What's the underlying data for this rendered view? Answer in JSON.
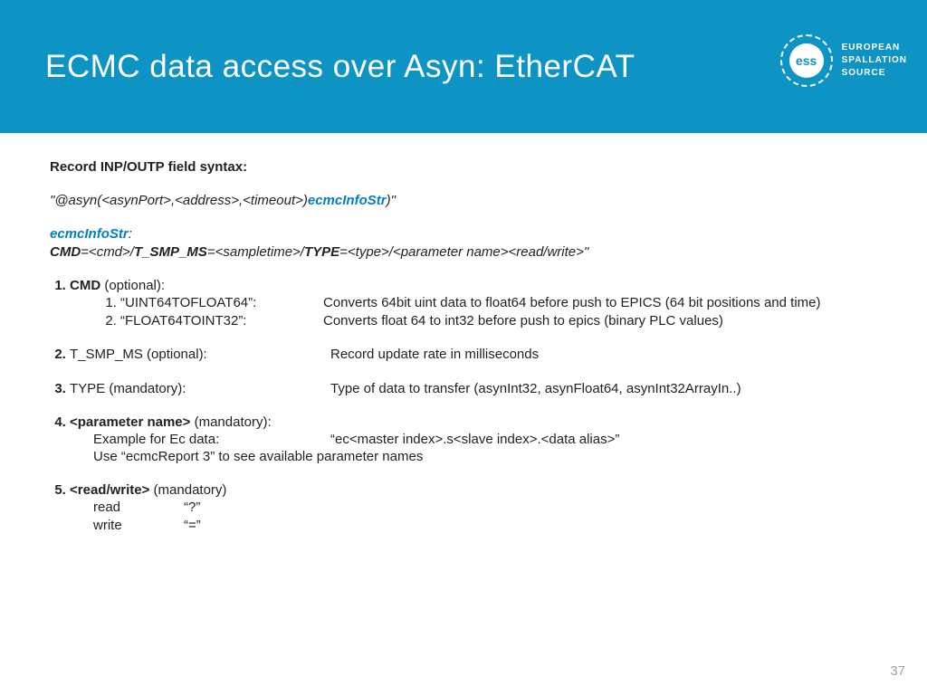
{
  "header": {
    "title": "ECMC data access over Asyn: EtherCAT",
    "org_line1": "EUROPEAN",
    "org_line2": "SPALLATION",
    "org_line3": "SOURCE",
    "logo_text": "ess"
  },
  "section_heading": "Record INP/OUTP field syntax:",
  "syntax": {
    "prefix": "\"@asyn(<asynPort>,<address>,<timeout>)",
    "info": "ecmcInfoStr",
    "suffix": ")\""
  },
  "info_heading": "ecmcInfoStr",
  "info_colon": ":",
  "def": {
    "p1": "CMD",
    "p2": "=<cmd>/",
    "p3": "T_SMP_MS",
    "p4": "=<sampletime>/",
    "p5": "TYPE",
    "p6": "=<type>/<parameter name><read/write>\""
  },
  "items": {
    "i1_name": "CMD",
    "i1_note": " (optional):",
    "i1_sub1_label": "“UINT64TOFLOAT64”:",
    "i1_sub1_desc": "Converts 64bit uint data to float64 before push to EPICS (64 bit positions and time)",
    "i1_sub2_label": "“FLOAT64TOINT32”:",
    "i1_sub2_desc": "Converts float 64 to int32  before push to epics (binary PLC values)",
    "i2_name": "T_SMP_MS",
    "i2_note": " (optional):",
    "i2_desc": "Record update rate in milliseconds",
    "i3_name": "TYPE",
    "i3_note": " (mandatory):",
    "i3_desc": "Type of data to transfer (asynInt32, asynFloat64, asynInt32ArrayIn..)",
    "i4_name": "<parameter name>",
    "i4_note": " (mandatory):",
    "i4_ex_label": "Example for Ec data:",
    "i4_ex_value": "“ec<master index>.s<slave index>.<data alias>”",
    "i4_hint": "Use “ecmcReport 3” to see available parameter names",
    "i5_name": "<read/write>",
    "i5_note": " (mandatory)",
    "i5_read_label": "read",
    "i5_read_value": "“?”",
    "i5_write_label": "write",
    "i5_write_value": "“=”"
  },
  "page": "37"
}
